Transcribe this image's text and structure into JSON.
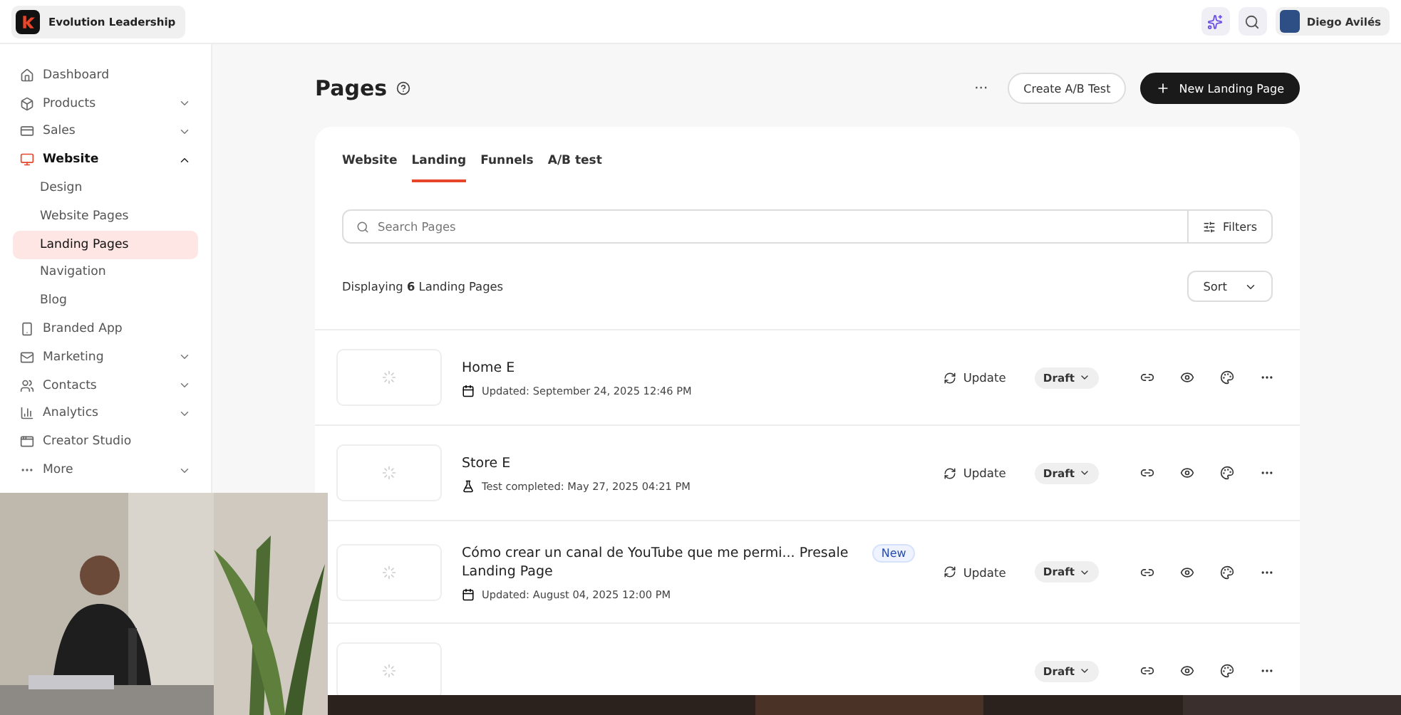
{
  "topbar": {
    "brand": "Evolution Leadership",
    "user": "Diego Avilés"
  },
  "sidebar": {
    "items": [
      {
        "label": "Dashboard",
        "selected": false
      },
      {
        "label": "Products",
        "expanded": false,
        "selected": false
      },
      {
        "label": "Sales",
        "expanded": false,
        "selected": false
      },
      {
        "label": "Website",
        "expanded": true,
        "selected": true,
        "children": [
          {
            "label": "Design",
            "selected": false
          },
          {
            "label": "Website Pages",
            "selected": false
          },
          {
            "label": "Landing Pages",
            "selected": true
          },
          {
            "label": "Navigation",
            "selected": false
          },
          {
            "label": "Blog",
            "selected": false
          }
        ]
      },
      {
        "label": "Branded App",
        "selected": false
      },
      {
        "label": "Marketing",
        "expanded": false,
        "selected": false
      },
      {
        "label": "Contacts",
        "expanded": false,
        "selected": false
      },
      {
        "label": "Analytics",
        "expanded": false,
        "selected": false
      },
      {
        "label": "Creator Studio",
        "selected": false
      },
      {
        "label": "More",
        "expanded": false,
        "selected": false
      }
    ]
  },
  "header": {
    "title": "Pages",
    "more": "···",
    "secondary_button": "Create A/B Test",
    "primary_button": "New Landing Page"
  },
  "tabs": [
    {
      "label": "Website",
      "selected": false
    },
    {
      "label": "Landing",
      "selected": true
    },
    {
      "label": "Funnels",
      "selected": false
    },
    {
      "label": "A/B test",
      "selected": false
    }
  ],
  "search": {
    "placeholder": "Search Pages",
    "filters": "Filters"
  },
  "summary": "Displaying **6** Landing Pages",
  "sort": "Sort",
  "rows": [
    {
      "title": "Home E",
      "kind": "updated",
      "meta": "Updated: September 24, 2025 12:46 PM",
      "update": "Update",
      "status": "Draft"
    },
    {
      "title": "Store E",
      "kind": "test",
      "meta": "Test completed: May 27, 2025 04:21 PM",
      "update": "Update",
      "status": "Draft"
    },
    {
      "title": "Cómo crear un canal de YouTube que me permi... Presale Landing Page",
      "kind": "updated",
      "meta": "Updated: August 04, 2025 12:00 PM",
      "badge": "New",
      "update": "Update",
      "status": "Draft"
    },
    {
      "status": "Draft"
    }
  ]
}
